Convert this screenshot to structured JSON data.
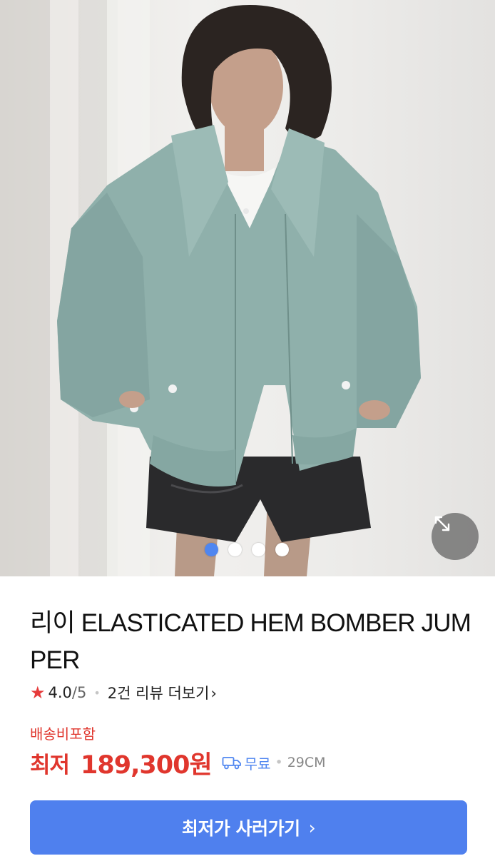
{
  "gallery": {
    "image_alt": "",
    "dots_total": 4,
    "active_index": 0,
    "expand_icon": "expand-arrows-icon"
  },
  "product": {
    "title": "리이 ELASTICATED HEM BOMBER JUMPER",
    "rating": "4.0",
    "rating_max": "/5",
    "review_link": "2건 리뷰 더보기"
  },
  "pricing": {
    "shipping_note": "배송비포함",
    "label": "최저",
    "price": "189,300원",
    "shipping": "무료",
    "store": "29CM"
  },
  "cta": {
    "label": "최저가 사러가기"
  },
  "colors": {
    "accent": "#4f80ee",
    "price_red": "#e0362d",
    "star": "#e63a3a",
    "jacket": "#8fb0ab"
  }
}
